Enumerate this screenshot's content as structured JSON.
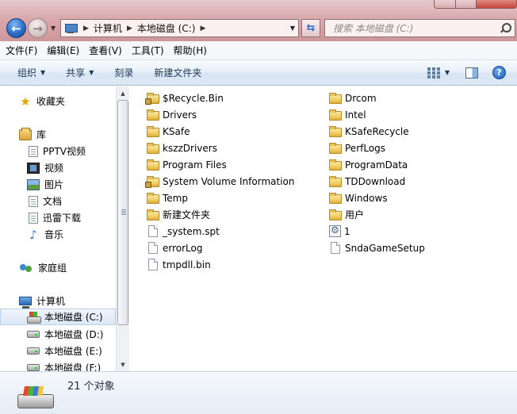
{
  "address": {
    "crumbs": [
      "计算机",
      "本地磁盘 (C:)"
    ]
  },
  "search": {
    "placeholder": "搜索 本地磁盘 (C:)"
  },
  "menu": [
    "文件(F)",
    "编辑(E)",
    "查看(V)",
    "工具(T)",
    "帮助(H)"
  ],
  "toolbar": {
    "organize": "组织",
    "share": "共享",
    "burn": "刻录",
    "new_folder": "新建文件夹"
  },
  "nav": {
    "favorites": "收藏夹",
    "libraries": "库",
    "library_items": [
      "PPTV视频",
      "视频",
      "图片",
      "文档",
      "迅雷下载",
      "音乐"
    ],
    "homegroup": "家庭组",
    "computer": "计算机",
    "drives": [
      "本地磁盘 (C:)",
      "本地磁盘 (D:)",
      "本地磁盘 (E:)",
      "本地磁盘 (F:)"
    ]
  },
  "files": {
    "col1": [
      {
        "name": "$Recycle.Bin",
        "icon": "locked-folder-icon"
      },
      {
        "name": "Drivers",
        "icon": "folder-icon"
      },
      {
        "name": "KSafe",
        "icon": "folder-icon"
      },
      {
        "name": "kszzDrivers",
        "icon": "folder-icon"
      },
      {
        "name": "Program Files",
        "icon": "folder-icon"
      },
      {
        "name": "System Volume Information",
        "icon": "locked-folder-icon"
      },
      {
        "name": "Temp",
        "icon": "folder-icon"
      },
      {
        "name": "新建文件夹",
        "icon": "folder-icon"
      },
      {
        "name": "_system.spt",
        "icon": "file-icon"
      },
      {
        "name": "errorLog",
        "icon": "file-icon"
      },
      {
        "name": "tmpdll.bin",
        "icon": "file-icon"
      }
    ],
    "col2": [
      {
        "name": "Drcom",
        "icon": "folder-icon"
      },
      {
        "name": "Intel",
        "icon": "folder-icon"
      },
      {
        "name": "KSafeRecycle",
        "icon": "folder-icon"
      },
      {
        "name": "PerfLogs",
        "icon": "folder-icon"
      },
      {
        "name": "ProgramData",
        "icon": "folder-icon"
      },
      {
        "name": "TDDownload",
        "icon": "folder-icon"
      },
      {
        "name": "Windows",
        "icon": "folder-icon"
      },
      {
        "name": "用户",
        "icon": "folder-icon"
      },
      {
        "name": "1",
        "icon": "gear-file-icon"
      },
      {
        "name": "SndaGameSetup",
        "icon": "file-icon"
      }
    ]
  },
  "details": {
    "count": "21 个对象"
  }
}
